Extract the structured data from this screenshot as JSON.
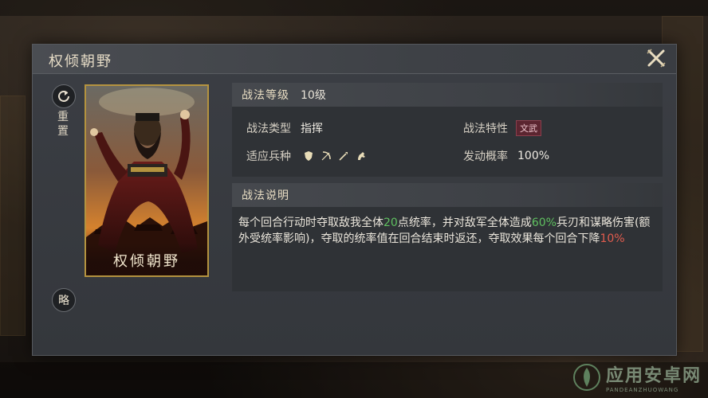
{
  "title": "权倾朝野",
  "side": {
    "reset_label": "重置",
    "lue_label": "略"
  },
  "card": {
    "name": "权倾朝野",
    "border_color": "#b4933f"
  },
  "level": {
    "label": "战法等级",
    "value": "10级"
  },
  "info": {
    "type_label": "战法类型",
    "type_value": "指挥",
    "trait_label": "战法特性",
    "trait_value": "文武",
    "troops_label": "适应兵种",
    "troops": [
      "shield-icon",
      "bow-icon",
      "spear-icon",
      "horse-icon"
    ],
    "chance_label": "发动概率",
    "chance_value": "100%"
  },
  "description": {
    "label": "战法说明",
    "p1": "每个回合行动时夺取敌我全体",
    "v1": "20",
    "p2": "点统率，并对敌军全体造成",
    "v2": "60%",
    "p3": "兵刃和谋略伤害(额外受统率影响)，夺取的统率值在回合结束时返还，夺取效果每个回合下降",
    "v3": "10%"
  },
  "colors": {
    "accent_gold": "#b4933f",
    "green_value": "#5fc060",
    "red_value": "#e25c4e",
    "tag_bg": "#5b2530"
  },
  "watermark": {
    "text": "应用安卓网",
    "sub": "PANDEANZHUOWANG"
  }
}
